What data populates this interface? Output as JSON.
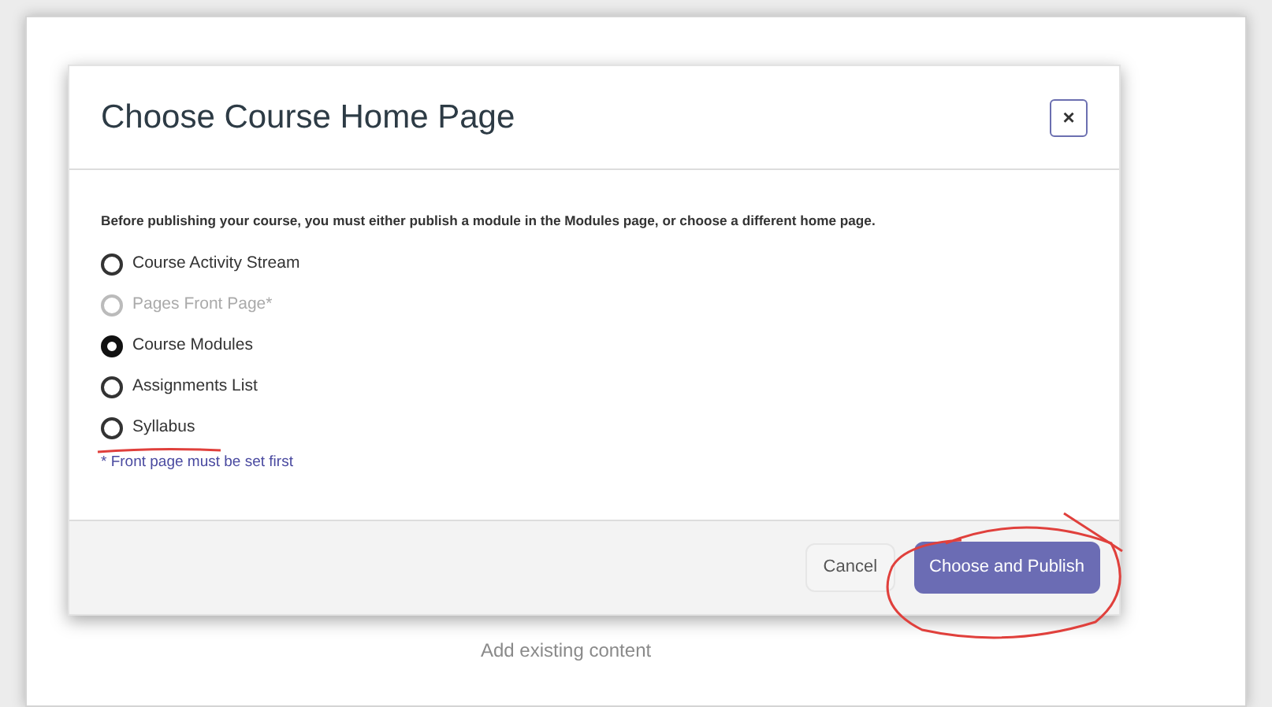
{
  "dialog": {
    "title": "Choose Course Home Page",
    "close": "×",
    "message": "Before publishing your course, you must either publish a module in the Modules page, or choose a different home page.",
    "options": [
      {
        "label": "Course Activity Stream",
        "selected": false,
        "disabled": false
      },
      {
        "label": "Pages Front Page*",
        "selected": false,
        "disabled": true
      },
      {
        "label": "Course Modules",
        "selected": true,
        "disabled": false
      },
      {
        "label": "Assignments List",
        "selected": false,
        "disabled": false
      },
      {
        "label": "Syllabus",
        "selected": false,
        "disabled": false
      }
    ],
    "note": "* Front page must be set first",
    "buttons": [
      {
        "label": "Cancel",
        "kind": "secondary"
      },
      {
        "label": "Choose and Publish",
        "kind": "primary"
      }
    ]
  },
  "background": {
    "text": "Add existing content"
  }
}
